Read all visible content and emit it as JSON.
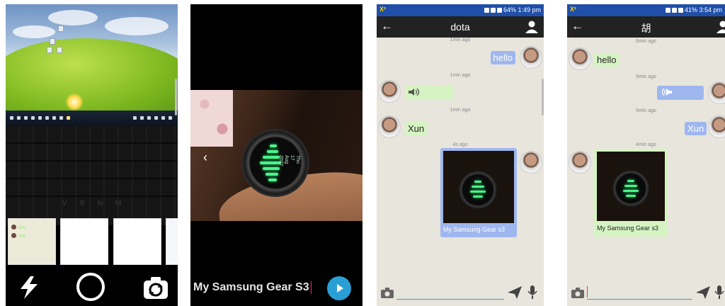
{
  "camera_screen": {
    "keyboard_letters": [
      "V",
      "B",
      "N",
      "M"
    ]
  },
  "preview_screen": {
    "caption_value": "My Samsung Gear S3",
    "watch_text": "Thu 17 Aug 2027"
  },
  "chat_dota": {
    "status_left": "X²",
    "status_right": "64% 1:49 pm",
    "title": "dota",
    "messages": [
      {
        "time": "1min ago",
        "side": "me",
        "text": "hello"
      },
      {
        "time": "1min ago",
        "side": "other",
        "type": "voice"
      },
      {
        "time": "1min ago",
        "side": "other",
        "text": "Xun"
      },
      {
        "time": "4s ago",
        "side": "me",
        "type": "image",
        "caption": "My Samsung Gear s3"
      }
    ]
  },
  "chat_hu": {
    "status_left": "X²",
    "status_right": "41% 3:54 pm",
    "title": "胡",
    "messages": [
      {
        "time": "6min ago",
        "side": "other",
        "text": "hello"
      },
      {
        "time": "5min ago",
        "side": "me",
        "type": "voice"
      },
      {
        "time": "5min ago",
        "side": "me",
        "text": "Xun"
      },
      {
        "time": "4min ago",
        "side": "other",
        "type": "image",
        "caption": "My Samsung Gear s3"
      }
    ]
  },
  "colors": {
    "status_bar": "#1f4fa8",
    "app_bar": "#222222",
    "chat_background": "#e8e5dc",
    "bubble_me": "#9fb7ef",
    "bubble_other": "#d6f4c3",
    "accent": "#2a9fd6"
  }
}
